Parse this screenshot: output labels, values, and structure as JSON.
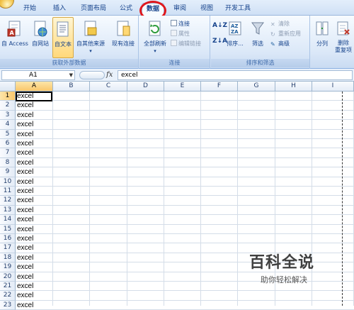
{
  "tabs": [
    "开始",
    "插入",
    "页面布局",
    "公式",
    "数据",
    "审阅",
    "视图",
    "开发工具"
  ],
  "active_tab": "数据",
  "ribbon": {
    "get_external": {
      "label": "获取外部数据",
      "buttons": [
        "自 Access",
        "自网站",
        "自文本",
        "自其他来源",
        "现有连接"
      ]
    },
    "connections": {
      "label": "连接",
      "refresh_all": "全部刷新",
      "small": [
        "连接",
        "属性",
        "编辑链接"
      ]
    },
    "sort_filter": {
      "label": "排序和筛选",
      "sort": "排序...",
      "filter": "筛选",
      "small": [
        "清除",
        "重新应用",
        "高级"
      ]
    },
    "tools": {
      "split": "分列",
      "remove_dup_1": "删除",
      "remove_dup_2": "重复项"
    }
  },
  "formula_bar": {
    "name_box": "A1",
    "fx": "fx",
    "formula": "excel"
  },
  "columns": [
    "A",
    "B",
    "C",
    "D",
    "E",
    "F",
    "G",
    "H",
    "I"
  ],
  "rows": [
    "1",
    "2",
    "3",
    "4",
    "5",
    "6",
    "7",
    "8",
    "9",
    "10",
    "11",
    "12",
    "13",
    "14",
    "15",
    "16",
    "17",
    "18",
    "19",
    "20",
    "21",
    "22",
    "23"
  ],
  "cell_values_col_A": [
    "excel",
    "excel",
    "excel",
    "excel",
    "excel",
    "excel",
    "excel",
    "excel",
    "excel",
    "excel",
    "excel",
    "excel",
    "excel",
    "excel",
    "excel",
    "excel",
    "excel",
    "excel",
    "excel",
    "excel",
    "excel",
    "excel",
    "excel"
  ],
  "watermark": {
    "logo": "百科全说",
    "tagline": "助你轻松解决"
  },
  "colors": {
    "highlight_ring": "#e0181d",
    "selection_header": "#f9c76b"
  }
}
